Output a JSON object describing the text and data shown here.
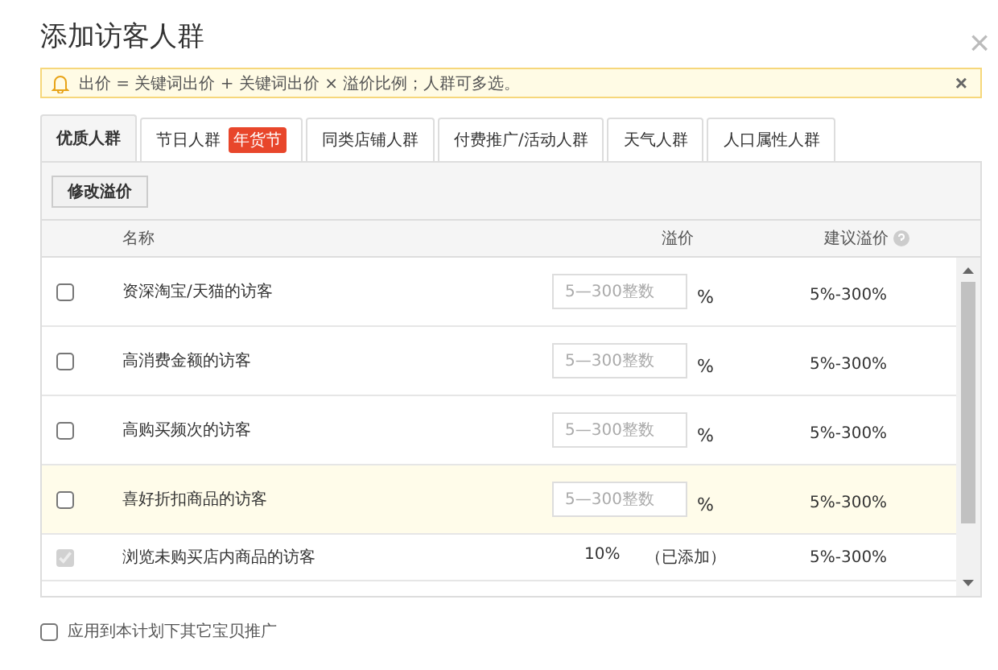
{
  "dialog": {
    "title": "添加访客人群",
    "close": "×"
  },
  "notice": {
    "text": "出价 = 关键词出价 + 关键词出价 × 溢价比例；人群可多选。",
    "close": "×"
  },
  "tabs": [
    {
      "label": "优质人群",
      "selected": true
    },
    {
      "label": "节日人群",
      "selected": false,
      "badge": "年货节"
    },
    {
      "label": "同类店铺人群",
      "selected": false
    },
    {
      "label": "付费推广/活动人群",
      "selected": false
    },
    {
      "label": "天气人群",
      "selected": false
    },
    {
      "label": "人口属性人群",
      "selected": false
    }
  ],
  "toolbar": {
    "button": "修改溢价"
  },
  "table": {
    "columns": [
      "名称",
      "溢价",
      "建议溢价"
    ],
    "rows": [
      {
        "kind": "input",
        "name": "资深淘宝/天猫的访客",
        "checked": false,
        "disabled": false,
        "highlighted": false,
        "placeholder": "5—300整数",
        "unit": "%",
        "suggested": "5%-300%"
      },
      {
        "kind": "input",
        "name": "高消费金额的访客",
        "checked": false,
        "disabled": false,
        "highlighted": false,
        "placeholder": "5—300整数",
        "unit": "%",
        "suggested": "5%-300%"
      },
      {
        "kind": "input",
        "name": "高购买频次的访客",
        "checked": false,
        "disabled": false,
        "highlighted": false,
        "placeholder": "5—300整数",
        "unit": "%",
        "suggested": "5%-300%"
      },
      {
        "kind": "input",
        "name": "喜好折扣商品的访客",
        "checked": false,
        "disabled": false,
        "highlighted": true,
        "placeholder": "5—300整数",
        "unit": "%",
        "suggested": "5%-300%"
      },
      {
        "kind": "added",
        "name": "浏览未购买店内商品的访客",
        "checked": true,
        "disabled": true,
        "highlighted": false,
        "value": "10%",
        "status": "（已添加）",
        "suggested": "5%-300%"
      }
    ]
  },
  "footer": {
    "label": "应用到本计划下其它宝贝推广",
    "checked": false
  }
}
